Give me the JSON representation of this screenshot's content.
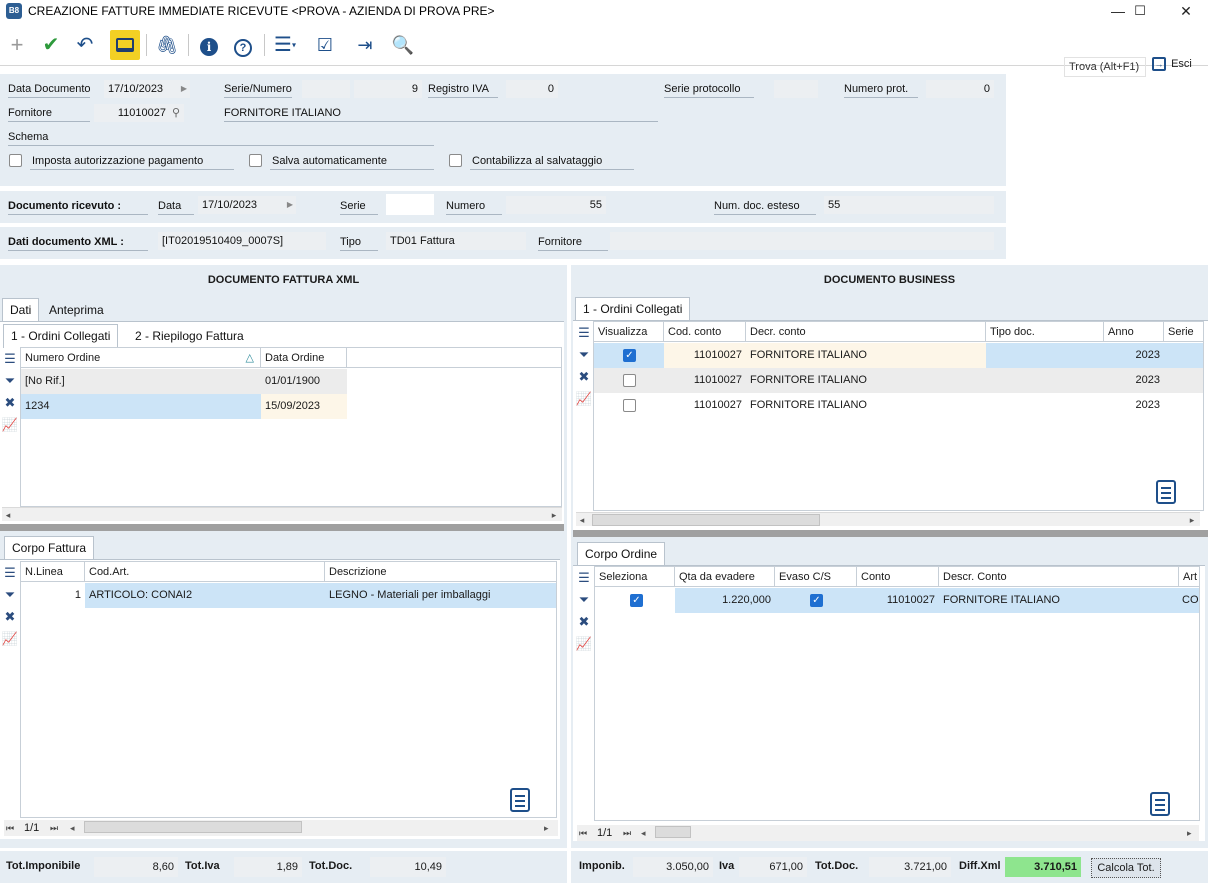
{
  "window": {
    "logo": "B8",
    "title": "CREAZIONE FATTURE IMMEDIATE RICEVUTE <PROVA - AZIENDA DI PROVA PRE>",
    "minimize": "—",
    "maximize": "☐",
    "close": "✕"
  },
  "toolbar": {
    "find_label": "Trova (Alt+F1)",
    "exit_label": "Esci"
  },
  "header": {
    "data_documento_label": "Data Documento",
    "data_documento": "17/10/2023",
    "serie_numero_label": "Serie/Numero",
    "serie": "",
    "numero": "9",
    "registro_iva_label": "Registro IVA",
    "registro_iva": "0",
    "serie_protocollo_label": "Serie protocollo",
    "serie_protocollo": "",
    "numero_prot_label": "Numero prot.",
    "numero_prot": "0",
    "fornitore_label": "Fornitore",
    "fornitore_code": "11010027",
    "fornitore_name": "FORNITORE ITALIANO",
    "schema_label": "Schema",
    "check_imposta": "Imposta autorizzazione pagamento",
    "check_salva": "Salva automaticamente",
    "check_contabilizza": "Contabilizza al salvataggio"
  },
  "received": {
    "label": "Documento ricevuto :",
    "data_label": "Data",
    "data": "17/10/2023",
    "serie_label": "Serie",
    "serie": "",
    "numero_label": "Numero",
    "numero": "55",
    "num_esteso_label": "Num. doc. esteso",
    "num_esteso": "55"
  },
  "xml": {
    "label": "Dati documento XML :",
    "file": "[IT02019510409_0007S]",
    "tipo_label": "Tipo",
    "tipo": "TD01 Fattura",
    "fornitore_label": "Fornitore",
    "fornitore": ""
  },
  "left": {
    "title": "DOCUMENTO FATTURA XML",
    "tabs": [
      "Dati",
      "Anteprima"
    ],
    "subtabs": [
      "1 - Ordini Collegati",
      "2 - Riepilogo Fattura"
    ],
    "orders_cols": [
      "Numero Ordine",
      "Data Ordine"
    ],
    "orders": [
      {
        "numero": "[No Rif.]",
        "data": "01/01/1900"
      },
      {
        "numero": "1234",
        "data": "15/09/2023"
      }
    ],
    "body_tab": "Corpo Fattura",
    "body_cols": [
      "N.Linea",
      "Cod.Art.",
      "Descrizione"
    ],
    "body_rows": [
      {
        "linea": "1",
        "codart": "ARTICOLO: CONAI2",
        "descr": "LEGNO - Materiali per imballaggi"
      }
    ],
    "pager": "1/1"
  },
  "right": {
    "title": "DOCUMENTO BUSINESS",
    "tab": "1 - Ordini Collegati",
    "orders_cols": [
      "Visualizza",
      "Cod. conto",
      "Decr. conto",
      "Tipo doc.",
      "Anno",
      "Serie"
    ],
    "orders": [
      {
        "checked": true,
        "cod": "11010027",
        "descr": "FORNITORE ITALIANO",
        "tipo": "",
        "anno": "2023",
        "serie": ""
      },
      {
        "checked": false,
        "cod": "11010027",
        "descr": "FORNITORE ITALIANO",
        "tipo": "",
        "anno": "2023",
        "serie": ""
      },
      {
        "checked": false,
        "cod": "11010027",
        "descr": "FORNITORE ITALIANO",
        "tipo": "",
        "anno": "2023",
        "serie": ""
      }
    ],
    "body_tab": "Corpo Ordine",
    "body_cols": [
      "Seleziona",
      "Qta da evadere",
      "Evaso C/S",
      "Conto",
      "Descr. Conto",
      "Art"
    ],
    "body_rows": [
      {
        "sel": true,
        "qta": "1.220,000",
        "evaso": true,
        "conto": "11010027",
        "descr": "FORNITORE ITALIANO",
        "art": "CO"
      }
    ],
    "pager": "1/1"
  },
  "totals_left": {
    "imponibile_label": "Tot.Imponibile",
    "imponibile": "8,60",
    "iva_label": "Tot.Iva",
    "iva": "1,89",
    "doc_label": "Tot.Doc.",
    "doc": "10,49"
  },
  "totals_right": {
    "imponibile_label": "Imponib.",
    "imponibile": "3.050,00",
    "iva_label": "Iva",
    "iva": "671,00",
    "doc_label": "Tot.Doc.",
    "doc": "3.721,00",
    "diff_label": "Diff.Xml",
    "diff": "3.710,51",
    "calc_button": "Calcola Tot."
  },
  "colors": {
    "panel": "#e6edf3",
    "selected_row": "#cce4f7",
    "diff_highlight": "#8ee58e",
    "toolbar_active": "#f2d024"
  }
}
